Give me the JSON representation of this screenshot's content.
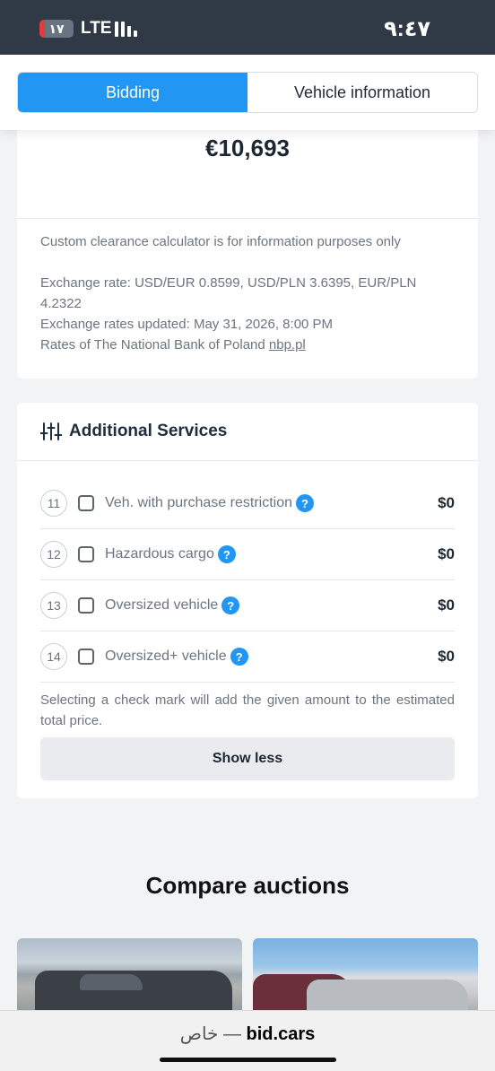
{
  "status_bar": {
    "battery": "١٧",
    "battery_level": 0.17,
    "network": "LTE",
    "time": "٩:٤٧"
  },
  "tabs": [
    {
      "label": "Bidding",
      "active": true
    },
    {
      "label": "Vehicle information",
      "active": false
    }
  ],
  "summary": {
    "total_price": "€10,693",
    "disclaimer": "Custom clearance calculator is for information purposes only",
    "exchange_rate": "Exchange rate: USD/EUR 0.8599, USD/PLN 3.6395, EUR/PLN 4.2322",
    "rates_updated": "Exchange rates updated: May 31, 2026, 8:00 PM",
    "rates_source": "Rates of The National Bank of Poland",
    "rates_link": "nbp.pl"
  },
  "additional_services": {
    "title": "Additional Services",
    "items": [
      {
        "number": "11",
        "label": "Veh. with purchase restriction",
        "price": "$0",
        "checked": false
      },
      {
        "number": "12",
        "label": "Hazardous cargo",
        "price": "$0",
        "checked": false
      },
      {
        "number": "13",
        "label": "Oversized vehicle",
        "price": "$0",
        "checked": false
      },
      {
        "number": "14",
        "label": "Oversized+ vehicle",
        "price": "$0",
        "checked": false
      }
    ],
    "help_glyph": "?",
    "note": "Selecting a check mark will add the given amount to the estimated total price.",
    "show_less": "Show less"
  },
  "compare": {
    "title": "Compare auctions"
  },
  "browser": {
    "domain": "bid.cars",
    "separator": " — ",
    "mode": "خاص"
  },
  "colors": {
    "accent": "#2196f3",
    "status_bar": "#2f3a46",
    "battery_low": "#e03d3d"
  }
}
